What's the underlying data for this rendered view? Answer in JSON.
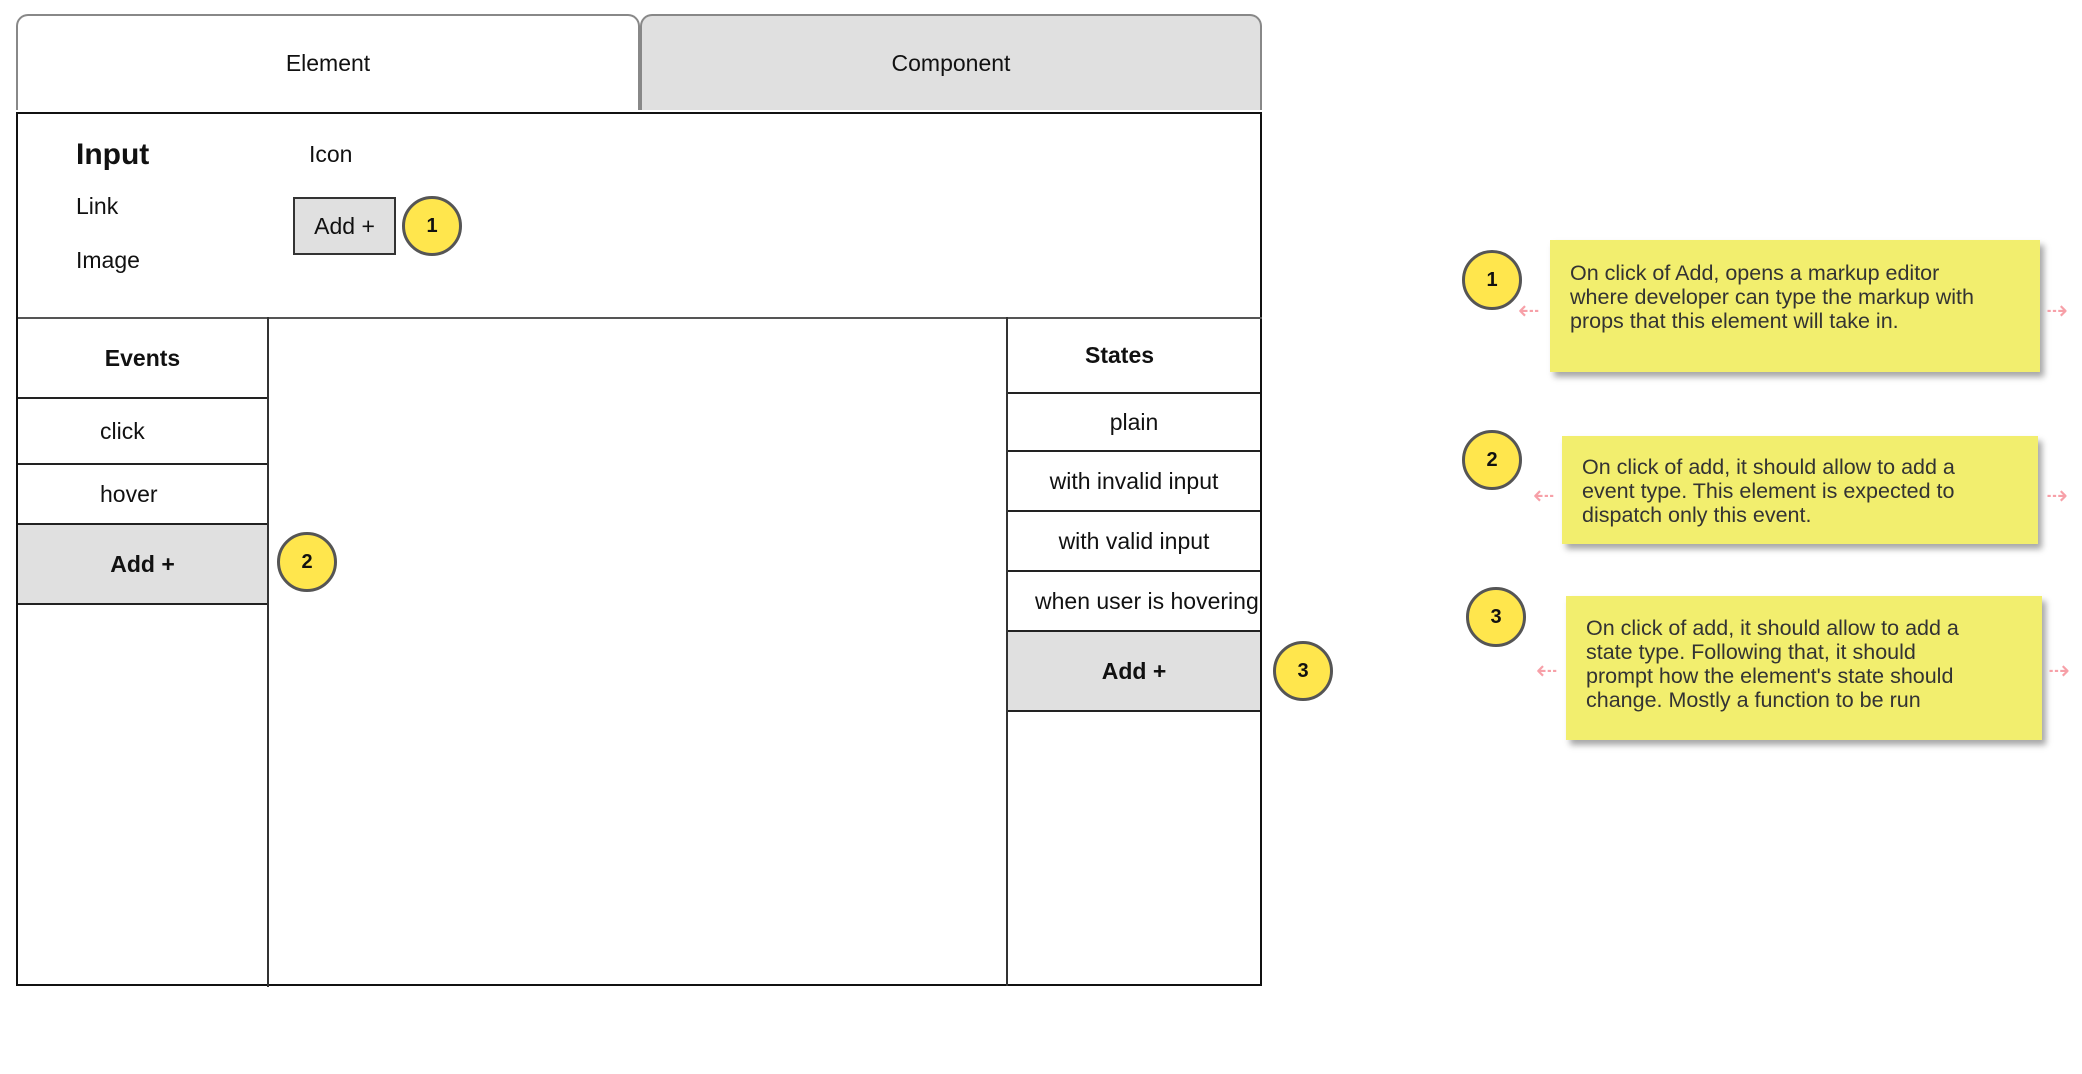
{
  "tabs": {
    "element": "Element",
    "component": "Component"
  },
  "element_types": {
    "input": "Input",
    "link": "Link",
    "image": "Image",
    "icon": "Icon",
    "add_button": "Add +"
  },
  "events": {
    "header": "Events",
    "items": [
      "click",
      "hover"
    ],
    "add_label": "Add +"
  },
  "states": {
    "header": "States",
    "items": [
      "plain",
      "with invalid input",
      "with valid input",
      "when user is hovering"
    ],
    "add_label": "Add +"
  },
  "markers": [
    "1",
    "2",
    "3"
  ],
  "notes": [
    {
      "marker": "1",
      "lines": [
        "On click of Add, opens a markup editor",
        "where developer can type the markup with",
        "props that this element will take in."
      ]
    },
    {
      "marker": "2",
      "lines": [
        "On click of add, it should allow to add a",
        "event type. This element is expected to",
        "dispatch only this event."
      ]
    },
    {
      "marker": "3",
      "lines": [
        "On click of add, it should allow to add a",
        "state type. Following that, it should",
        "prompt how the element's state should",
        "change. Mostly a function to be run"
      ]
    }
  ],
  "colors": {
    "marker_fill": "#ffe64d",
    "note_fill": "#f2ee6e",
    "add_fill": "#e0e0e0",
    "inactive_tab_fill": "#e0e0e0",
    "arrow_color": "#f7a0a8"
  }
}
